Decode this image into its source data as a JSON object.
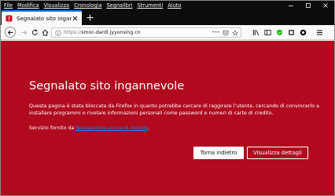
{
  "menubar": {
    "items": [
      "File",
      "Modifica",
      "Visualizza",
      "Cronologia",
      "Segnalibri",
      "Strumenti",
      "Aiuto"
    ]
  },
  "tab": {
    "title": "Segnalato sito ingannevole"
  },
  "toolbar": {
    "url_scheme": "https://",
    "url_host": "smoc-dardl.jyyunsing.cn",
    "page_actions_label": "•••"
  },
  "page": {
    "heading": "Segnalato sito ingannevole",
    "description": "Questa pagina è stata bloccata da Firefox in quanto potrebbe cercare di raggirare l’utente, cercando di convincerlo a installare programmi o rivelare informazioni personali come password e numeri di carte di credito.",
    "provider_prefix": "Servizio fornito da ",
    "provider_link": "Navigazione sicura di Google",
    "provider_suffix": ".",
    "primary_button": "Torna indietro",
    "secondary_button": "Visualizza dettagli"
  },
  "colors": {
    "page_background": "#b10a1e",
    "titlebar": "#0c0c0d",
    "accent": "#0a84ff"
  }
}
